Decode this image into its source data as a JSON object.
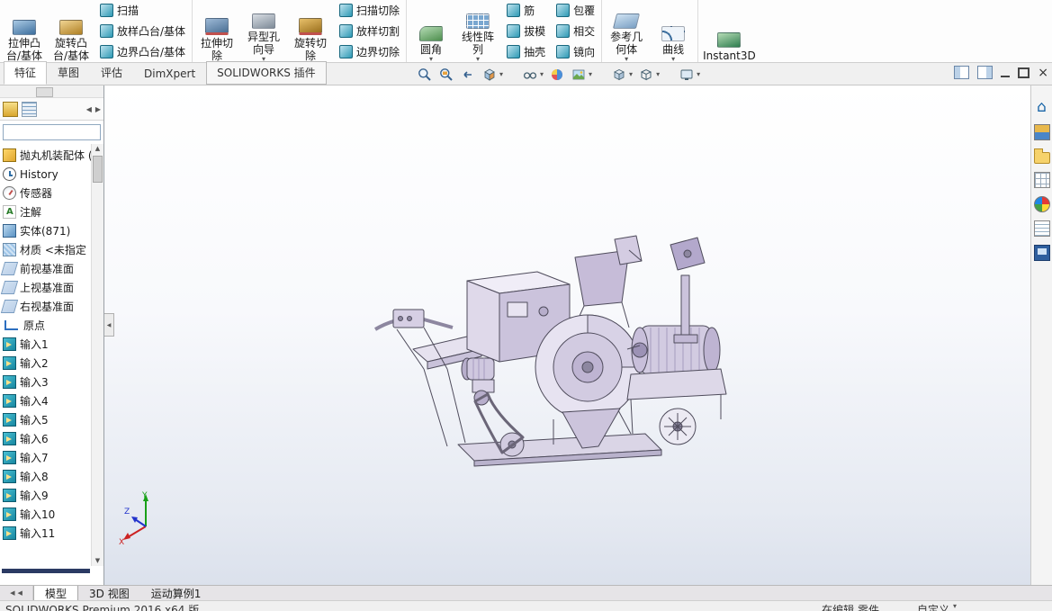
{
  "ribbon": {
    "large": [
      {
        "line1": "拉伸凸",
        "line2": "台/基体"
      },
      {
        "line1": "旋转凸",
        "line2": "台/基体"
      },
      {
        "line1": "拉伸切",
        "line2": "除"
      },
      {
        "line1": "异型孔",
        "line2": "向导"
      },
      {
        "line1": "旋转切",
        "line2": "除"
      },
      {
        "line1": "圆角",
        "line2": ""
      },
      {
        "line1": "线性阵",
        "line2": "列"
      },
      {
        "line1": "参考几",
        "line2": "何体"
      },
      {
        "line1": "曲线",
        "line2": ""
      },
      {
        "line1": "Instant3D",
        "line2": ""
      }
    ],
    "stack1": [
      "扫描",
      "放样凸台/基体",
      "边界凸台/基体"
    ],
    "stack2": [
      "扫描切除",
      "放样切割",
      "边界切除"
    ],
    "stack3": [
      "筋",
      "拔模",
      "抽壳"
    ],
    "stack4": [
      "包覆",
      "相交",
      "镜向"
    ]
  },
  "tab_bar": {
    "tabs": [
      "特征",
      "草图",
      "评估",
      "DimXpert",
      "SOLIDWORKS 插件"
    ],
    "active": "特征"
  },
  "hud_icons": [
    "zoom-fit",
    "zoom-to-area",
    "previous-view",
    "section-view",
    "hide-show-items",
    "edit-appearance",
    "apply-scene",
    "view-orientation",
    "display-style",
    "view-settings"
  ],
  "feature_tree": {
    "items": [
      "抛丸机装配体 (默",
      "History",
      "传感器",
      "注解",
      "实体(871)",
      "材质 <未指定",
      "前视基准面",
      "上视基准面",
      "右视基准面",
      "原点",
      "输入1",
      "输入2",
      "输入3",
      "输入4",
      "输入5",
      "输入6",
      "输入7",
      "输入8",
      "输入9",
      "输入10",
      "输入11"
    ]
  },
  "task_pane_icons": [
    "home",
    "design-library",
    "file-explorer",
    "view-palette",
    "appearances-scenes",
    "custom-properties",
    "solidworks-forum"
  ],
  "bottom_bar": {
    "tabs": [
      "模型",
      "3D 视图",
      "运动算例1"
    ],
    "active": "模型"
  },
  "status_bar": {
    "product": "SOLIDWORKS Premium 2016 x64 版",
    "editing": "在编辑 零件",
    "custom": "自定义"
  },
  "triad": {
    "x": "X",
    "y": "Y",
    "z": "Z"
  },
  "colors": {
    "model_lavender": "#cbc3dc",
    "model_light": "#e7e3f1",
    "viewport_bottom": "#dbe1ec",
    "rollback_bar": "#2b3a63",
    "import_icon_teal": "#1787a0"
  }
}
